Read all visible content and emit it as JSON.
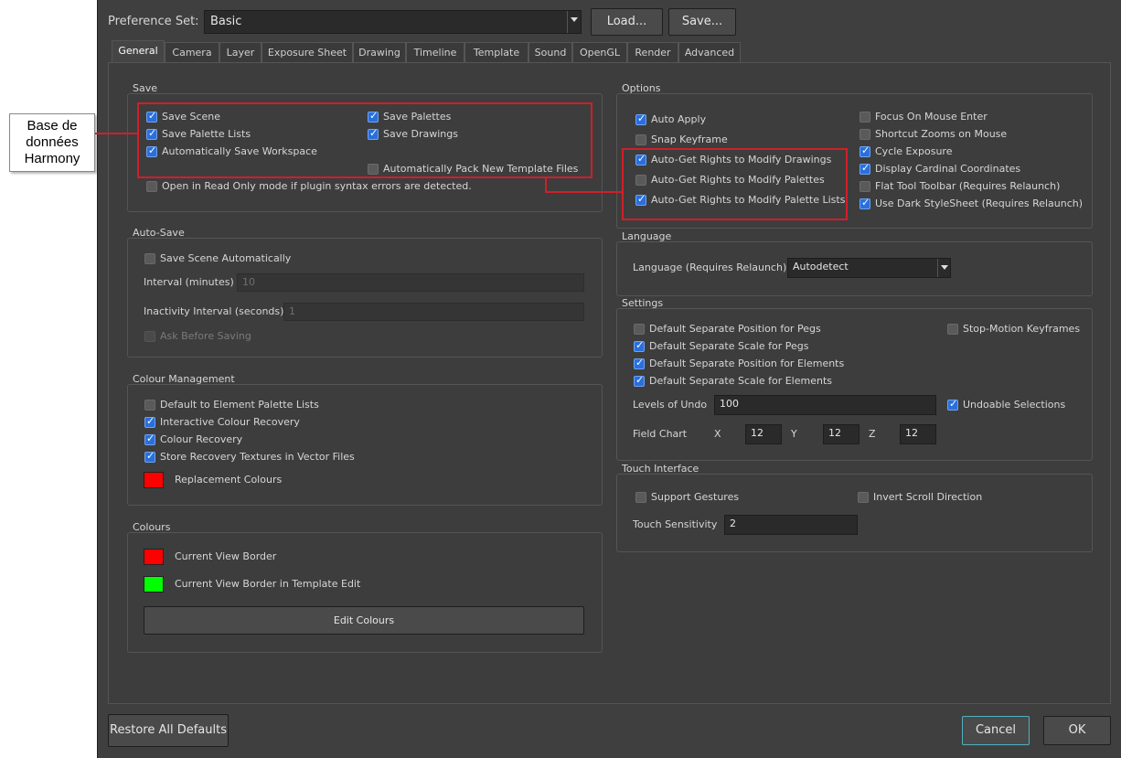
{
  "callout": {
    "text": "Base de données Harmony"
  },
  "header": {
    "preference_set_label": "Preference Set:",
    "preference_set_value": "Basic",
    "load_button": "Load...",
    "save_button": "Save..."
  },
  "tabs": [
    {
      "label": "General",
      "active": true
    },
    {
      "label": "Camera"
    },
    {
      "label": "Layer"
    },
    {
      "label": "Exposure Sheet"
    },
    {
      "label": "Drawing"
    },
    {
      "label": "Timeline"
    },
    {
      "label": "Template"
    },
    {
      "label": "Sound"
    },
    {
      "label": "OpenGL"
    },
    {
      "label": "Render"
    },
    {
      "label": "Advanced"
    }
  ],
  "save_group": {
    "title": "Save",
    "items": [
      {
        "label": "Save Scene",
        "checked": true
      },
      {
        "label": "Save Palette Lists",
        "checked": true
      },
      {
        "label": "Automatically Save Workspace",
        "checked": true
      },
      {
        "label": "Save Palettes",
        "checked": true
      },
      {
        "label": "Save Drawings",
        "checked": true
      },
      {
        "label": "Automatically Pack New Template Files",
        "checked": false
      },
      {
        "label": "Open in Read Only mode if plugin syntax errors are detected.",
        "checked": false
      }
    ]
  },
  "autosave_group": {
    "title": "Auto-Save",
    "save_scene_auto": {
      "label": "Save Scene Automatically",
      "checked": false
    },
    "interval_label": "Interval (minutes)",
    "interval_value": "10",
    "inactivity_label": "Inactivity Interval (seconds)",
    "inactivity_value": "1",
    "ask_before": {
      "label": "Ask Before Saving",
      "checked": false
    }
  },
  "colour_mgmt_group": {
    "title": "Colour Management",
    "items": [
      {
        "label": "Default to Element Palette Lists",
        "checked": false
      },
      {
        "label": "Interactive Colour Recovery",
        "checked": true
      },
      {
        "label": "Colour Recovery",
        "checked": true
      },
      {
        "label": "Store Recovery Textures in Vector Files",
        "checked": true
      }
    ],
    "replacement_label": "Replacement Colours",
    "replacement_color": "#ff0000"
  },
  "colours_group": {
    "title": "Colours",
    "view_border_label": "Current View Border",
    "view_border_color": "#ff0000",
    "template_border_label": "Current View Border in Template Edit",
    "template_border_color": "#00ff00",
    "edit_button": "Edit Colours"
  },
  "options_group": {
    "title": "Options",
    "left": [
      {
        "label": "Auto Apply",
        "checked": true
      },
      {
        "label": "Snap Keyframe",
        "checked": false
      },
      {
        "label": "Auto-Get Rights to Modify Drawings",
        "checked": true
      },
      {
        "label": "Auto-Get Rights to Modify Palettes",
        "checked": false
      },
      {
        "label": "Auto-Get Rights to Modify Palette Lists",
        "checked": true
      }
    ],
    "right": [
      {
        "label": "Focus On Mouse Enter",
        "checked": false
      },
      {
        "label": "Shortcut Zooms on Mouse",
        "checked": false
      },
      {
        "label": "Cycle Exposure",
        "checked": true
      },
      {
        "label": "Display Cardinal Coordinates",
        "checked": true
      },
      {
        "label": "Flat Tool Toolbar (Requires Relaunch)",
        "checked": false
      },
      {
        "label": "Use Dark StyleSheet (Requires Relaunch)",
        "checked": true
      }
    ]
  },
  "language_group": {
    "title": "Language",
    "label": "Language (Requires Relaunch)",
    "value": "Autodetect"
  },
  "settings_group": {
    "title": "Settings",
    "items": [
      {
        "label": "Default Separate Position for Pegs",
        "checked": false
      },
      {
        "label": "Default Separate Scale for Pegs",
        "checked": true
      },
      {
        "label": "Default Separate Position for Elements",
        "checked": true
      },
      {
        "label": "Default Separate Scale for Elements",
        "checked": true
      }
    ],
    "stop_motion": {
      "label": "Stop-Motion Keyframes",
      "checked": false
    },
    "levels_label": "Levels of Undo",
    "levels_value": "100",
    "undoable": {
      "label": "Undoable Selections",
      "checked": true
    },
    "field_chart_label": "Field Chart",
    "x_label": "X",
    "x_value": "12",
    "y_label": "Y",
    "y_value": "12",
    "z_label": "Z",
    "z_value": "12"
  },
  "touch_group": {
    "title": "Touch Interface",
    "support": {
      "label": "Support Gestures",
      "checked": false
    },
    "invert": {
      "label": "Invert Scroll Direction",
      "checked": false
    },
    "sensitivity_label": "Touch Sensitivity",
    "sensitivity_value": "2"
  },
  "footer": {
    "restore_button": "Restore All Defaults",
    "cancel_button": "Cancel",
    "ok_button": "OK"
  },
  "colors": {
    "highlight": "#d01f2a",
    "accent_check": "#2a6fdc"
  }
}
